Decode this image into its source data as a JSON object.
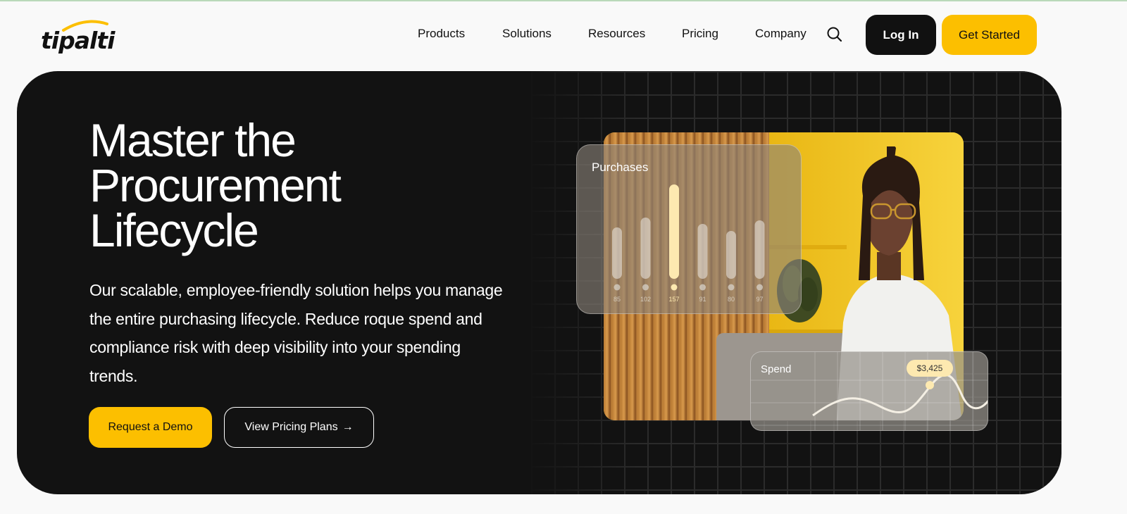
{
  "brand": {
    "name": "tipalti",
    "accent": "#fcbf00",
    "dark": "#121212"
  },
  "nav": {
    "items": [
      "Products",
      "Solutions",
      "Resources",
      "Pricing",
      "Company"
    ],
    "search_icon": "search-icon"
  },
  "header_actions": {
    "login_label": "Log In",
    "get_started_label": "Get Started"
  },
  "hero": {
    "title_lines": [
      "Master the",
      "Procurement",
      "Lifecycle"
    ],
    "lead": "Our scalable, employee-friendly solution helps you manage the entire purchasing lifecycle. Reduce roque spend and compliance risk with deep visibility into your spending trends.",
    "demo_label": "Request a Demo",
    "pricing_label": "View Pricing Plans",
    "pricing_arrow": "→"
  },
  "purchases_card": {
    "title": "Purchases",
    "values": [
      85,
      102,
      157,
      91,
      80,
      97
    ],
    "highlight_index": 2
  },
  "spend_card": {
    "title": "Spend",
    "badge": "$3,425"
  }
}
